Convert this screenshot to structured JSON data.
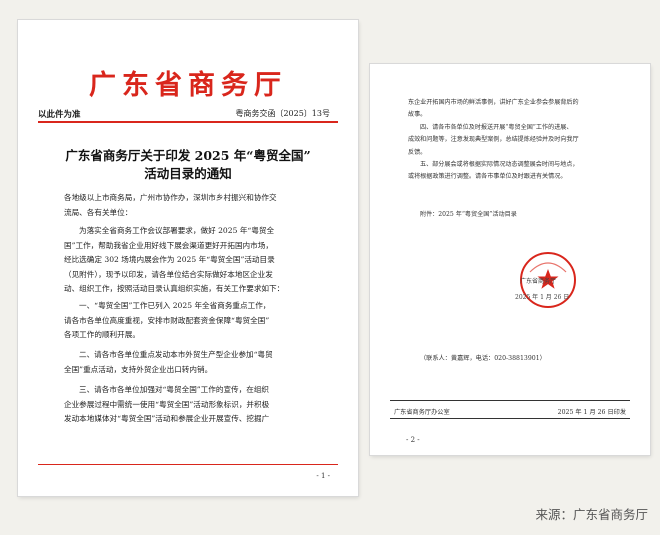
{
  "page1": {
    "header_org": "广东省商务厅",
    "print_basis": "以此件为准",
    "doc_number": "粤商务交函〔2025〕13号",
    "title_line1": "广东省商务厅关于印发 2025 年“粤贸全国”",
    "title_line2": "活动目录的通知",
    "salutation_1": "各地级以上市商务局，广州市协作办，深圳市乡村振兴和协作交",
    "salutation_2": "流局、各有关单位：",
    "para1": [
      "为落实全省商务工作会议部署要求，做好 2025 年“粤贸全",
      "国”工作，帮助我省企业用好线下展会渠道更好开拓国内市场，",
      "经比选确定 302 场境内展会作为 2025 年“粤贸全国”活动目录",
      "（见附件），现予以印发，请各单位结合实际做好本地区企业发",
      "动、组织工作，按照活动目录认真组织实施，有关工作要求如下："
    ],
    "para2": [
      "一、“粤贸全国”工作已列入 2025 年全省商务重点工作，",
      "请各市各单位高度重视，安排市财政配套资金保障“粤贸全国”",
      "各项工作的顺利开展。"
    ],
    "para3": [
      "二、请各市各单位重点发动本市外贸生产型企业参加“粤贸",
      "全国”重点活动，支持外贸企业出口转内销。"
    ],
    "para4": [
      "三、请各市各单位加强对“粤贸全国”工作的宣传，在组织",
      "企业参展过程中需统一使用“粤贸全国”活动形象标识，并积极",
      "发动本地媒体对“粤贸全国”活动和参展企业开展宣传、挖掘广"
    ],
    "page_number": "- 1 -"
  },
  "page2": {
    "lines": [
      "东企业开拓国内市场的鲜活事例，讲好广东企业参会参展背后的",
      "故事。",
      "四、请各市各单位及时报送开展“粤贸全国”工作的进展、",
      "成效和问题等，注意发现典型案例，总结提炼经验并及时向我厅",
      "反馈。",
      "五、部分展会或将根据实际情况动态调整展会时间与地点，",
      "或将根据政策进行调整。请各市事单位及时跟进有关情况。"
    ],
    "attachment": "附件：2025 年“粤贸全国”活动目录",
    "seal_text": "广东省商务厅",
    "seal_date": "2025 年 1 月 26 日",
    "contact": "（联系人：黄嘉辉，电话：020-38813901）",
    "footer_left": "广东省商务厅办公室",
    "footer_right": "2025 年 1 月 26 日印发",
    "page_number": "- 2 -"
  },
  "source_caption": "来源：广东省商务厅",
  "colors": {
    "accent_red": "#d9261c",
    "background": "#f2f1ec"
  }
}
